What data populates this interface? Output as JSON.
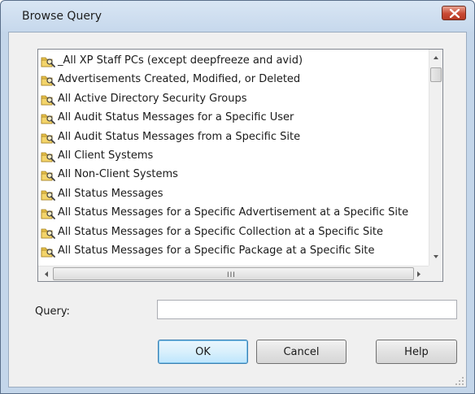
{
  "window": {
    "title": "Browse Query",
    "close_icon": "close-x-icon"
  },
  "list": {
    "item_icon": "query-folder-icon",
    "items": [
      {
        "label": "_All XP Staff PCs (except deepfreeze and avid)"
      },
      {
        "label": "Advertisements Created, Modified, or Deleted"
      },
      {
        "label": "All Active Directory Security Groups"
      },
      {
        "label": "All Audit Status Messages for a Specific User"
      },
      {
        "label": "All Audit Status Messages from a Specific Site"
      },
      {
        "label": "All Client Systems"
      },
      {
        "label": "All Non-Client Systems"
      },
      {
        "label": "All Status Messages"
      },
      {
        "label": "All Status Messages for a Specific Advertisement at a Specific Site"
      },
      {
        "label": "All Status Messages for a Specific Collection at a Specific Site"
      },
      {
        "label": "All Status Messages for a Specific Package at a Specific Site"
      }
    ],
    "hscroll_grip": "III"
  },
  "query": {
    "label": "Query:",
    "value": "",
    "placeholder": ""
  },
  "buttons": {
    "ok": "OK",
    "cancel": "Cancel",
    "help": "Help"
  },
  "colors": {
    "title_bar": "#c6d8ec",
    "close_button": "#c94a34",
    "dialog_background": "#f0f0f0",
    "default_button_border": "#3c7fb1"
  }
}
